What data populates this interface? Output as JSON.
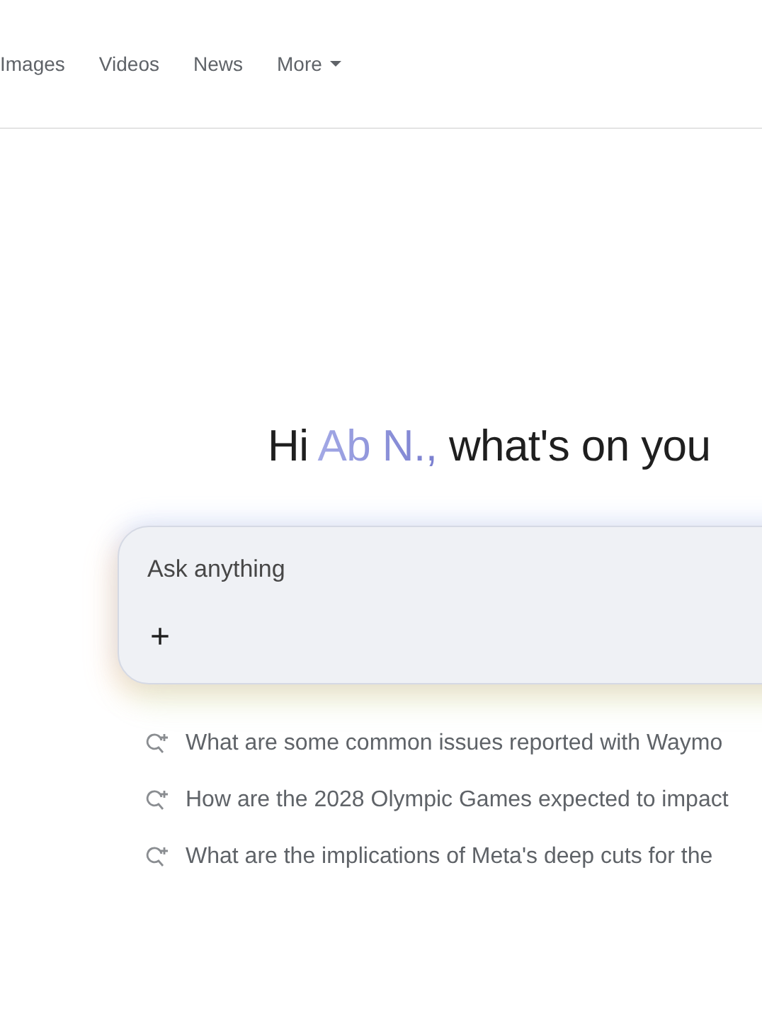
{
  "nav": [
    {
      "label": "Images"
    },
    {
      "label": "Videos"
    },
    {
      "label": "News"
    },
    {
      "label": "More",
      "kind": "dropdown"
    }
  ],
  "greeting": {
    "prefix": "Hi",
    "name": "Ab N.,",
    "rest": "what's on you"
  },
  "search": {
    "placeholder": "Ask anything",
    "add": "+"
  },
  "suggestions": [
    {
      "text": "What are some common issues reported with Waymo"
    },
    {
      "text": "How are the 2028 Olympic Games expected to impact"
    },
    {
      "text": "What are the implications of Meta's deep cuts for the"
    }
  ]
}
